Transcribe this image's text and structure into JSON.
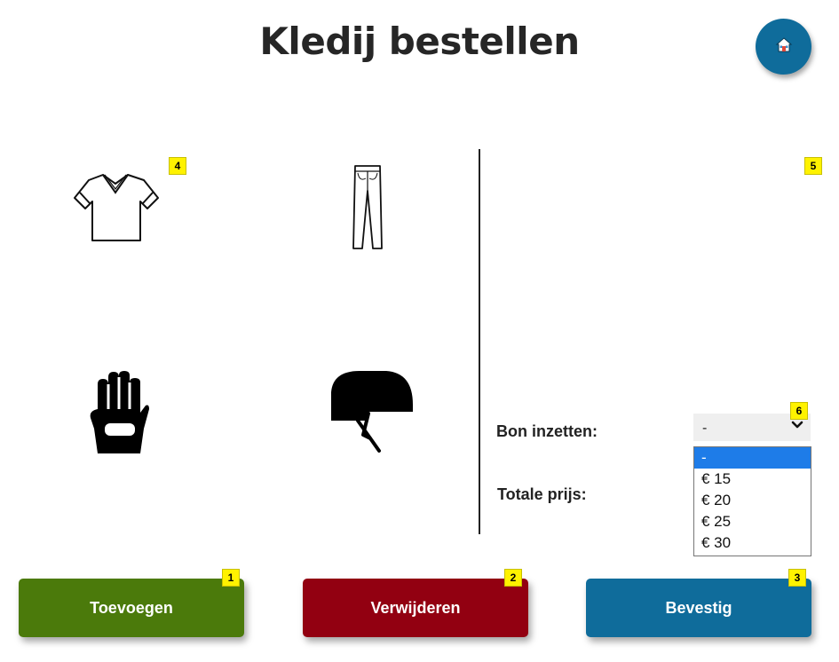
{
  "header": {
    "title": "Kledij bestellen"
  },
  "badges": {
    "add": "1",
    "remove": "2",
    "confirm": "3",
    "items": "4",
    "order": "5",
    "voucher": "6"
  },
  "items": [
    {
      "icon": "tshirt-icon"
    },
    {
      "icon": "pants-icon"
    },
    {
      "icon": "glove-icon"
    },
    {
      "icon": "helmet-icon"
    }
  ],
  "voucher": {
    "label": "Bon inzetten:",
    "selected": "-",
    "options": [
      "-",
      "€ 15",
      "€ 20",
      "€ 25",
      "€ 30"
    ]
  },
  "total": {
    "label": "Totale prijs:"
  },
  "buttons": {
    "add": "Toevoegen",
    "remove": "Verwijderen",
    "confirm": "Bevestig"
  },
  "colors": {
    "add": "#4b7a0b",
    "remove": "#920011",
    "confirm": "#0f6c9b",
    "home": "#0f6c9b",
    "badge": "#fff200",
    "dropdown_selected": "#1e7ce8"
  }
}
